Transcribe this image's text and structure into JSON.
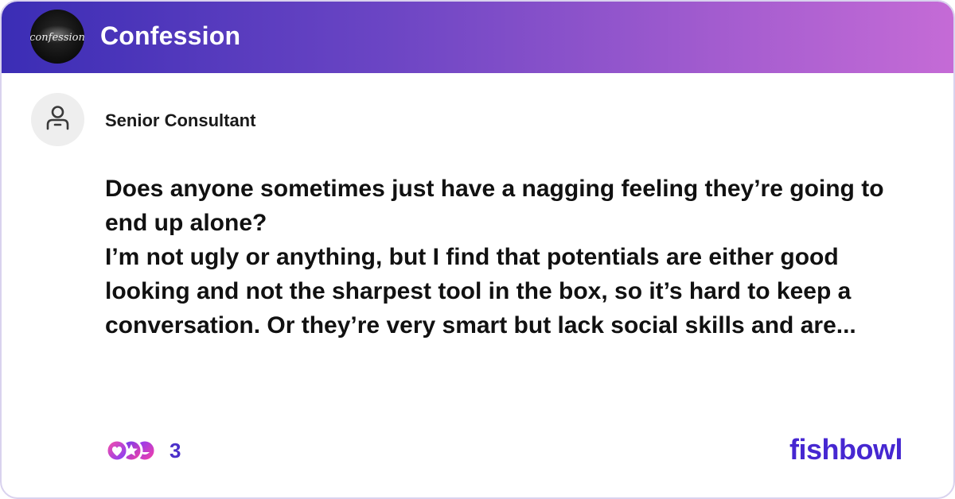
{
  "header": {
    "bowl_name": "Confession",
    "logo_text": "confession",
    "logo_icon": "confession-bowl-logo"
  },
  "post": {
    "author_icon": "user-avatar-icon",
    "author_title": "Senior Consultant",
    "body": "Does anyone sometimes just have a nagging feeling they’re going to end up alone?\nI’m not ugly or anything, but I find  that potentials are either good looking and not the sharpest tool in the box, so it’s hard to keep a conversation. Or they’re very smart but lack social skills and are..."
  },
  "footer": {
    "reaction_icons": [
      "heart-reaction-icon",
      "star-reaction-icon",
      "laugh-reaction-icon"
    ],
    "reaction_count": "3",
    "brand": "fishbowl"
  },
  "colors": {
    "header_gradient_start": "#3b2db5",
    "header_gradient_end": "#c56bd6",
    "brand": "#4627d1",
    "reaction_count": "#4b2fc9"
  }
}
